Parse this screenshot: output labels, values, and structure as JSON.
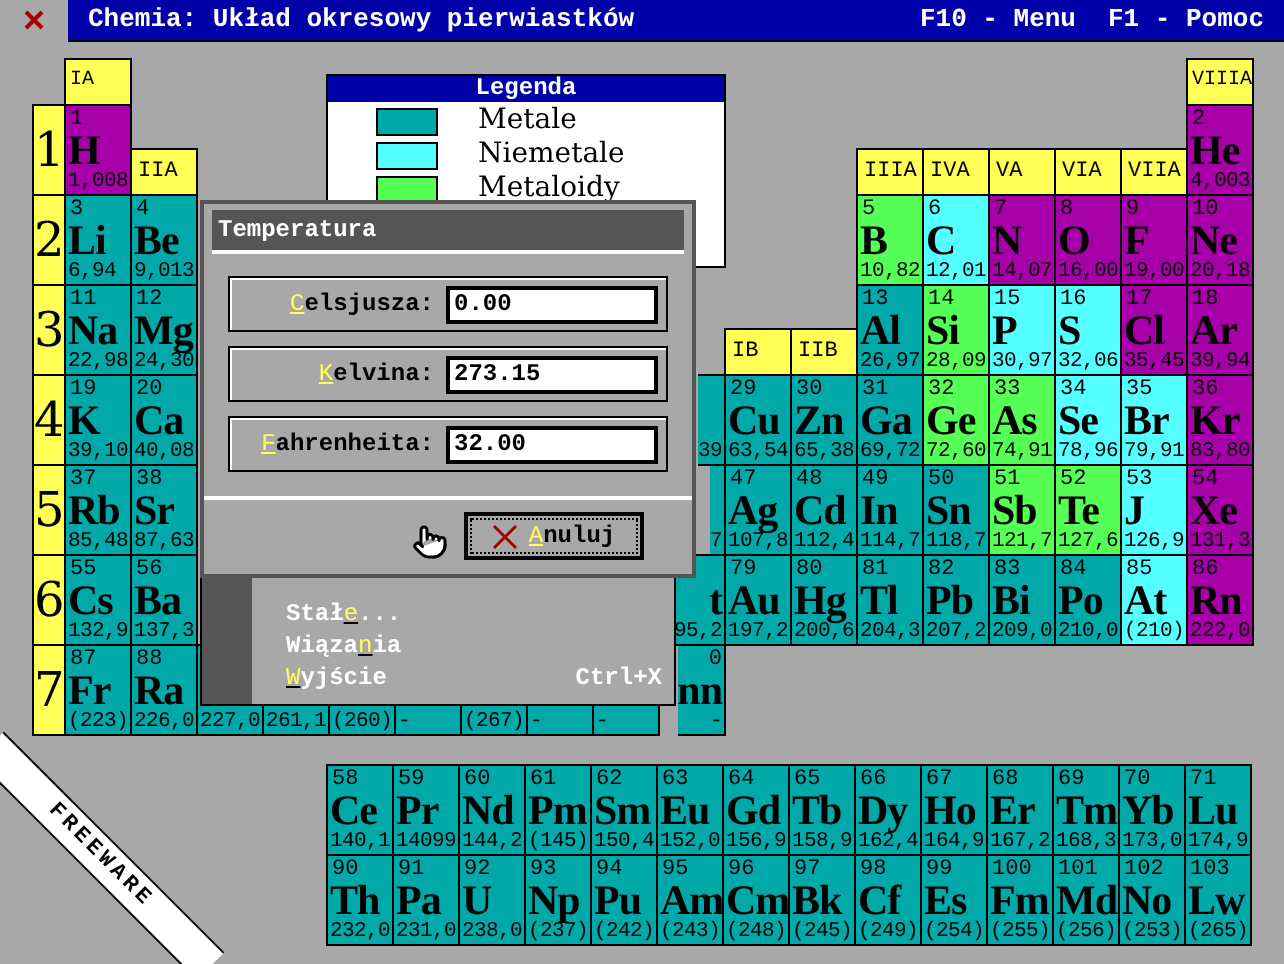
{
  "title_bar": {
    "title": "Chemia: Układ okresowy pierwiastków",
    "hints": [
      "F10 - Menu",
      "F1 - Pomoc"
    ]
  },
  "table": {
    "rows": [
      {
        "cells": [
          {
            "kind": "header",
            "text": "IA"
          },
          {
            "kind": "empty"
          },
          {
            "kind": "empty"
          },
          {
            "kind": "empty"
          },
          {
            "kind": "empty"
          },
          {
            "kind": "empty"
          },
          {
            "kind": "empty"
          },
          {
            "kind": "empty"
          },
          {
            "kind": "empty"
          },
          {
            "kind": "empty"
          },
          {
            "kind": "empty"
          },
          {
            "kind": "empty"
          },
          {
            "kind": "empty"
          },
          {
            "kind": "empty"
          },
          {
            "kind": "empty"
          },
          {
            "kind": "empty"
          },
          {
            "kind": "empty"
          },
          {
            "kind": "header",
            "text": "VIIIA"
          }
        ]
      },
      {
        "label": "1",
        "cells": [
          {
            "kind": "element",
            "number": "1",
            "symbol": "H",
            "mass": "1,008",
            "color": "#a800a8"
          },
          {
            "kind": "header",
            "text": "IIA"
          },
          {
            "kind": "empty"
          },
          {
            "kind": "empty"
          },
          {
            "kind": "empty"
          },
          {
            "kind": "empty"
          },
          {
            "kind": "empty"
          },
          {
            "kind": "empty"
          },
          {
            "kind": "empty"
          },
          {
            "kind": "empty"
          },
          {
            "kind": "empty"
          },
          {
            "kind": "empty"
          },
          {
            "kind": "header",
            "text": "IIIA"
          },
          {
            "kind": "header",
            "text": "IVA"
          },
          {
            "kind": "header",
            "text": "VA"
          },
          {
            "kind": "header",
            "text": "VIA"
          },
          {
            "kind": "header",
            "text": "VIIA"
          },
          {
            "kind": "element",
            "number": "2",
            "symbol": "He",
            "mass": "4,003",
            "color": "#a800a8"
          }
        ]
      },
      {
        "label": "2",
        "cells": [
          {
            "kind": "element",
            "number": "3",
            "symbol": "Li",
            "mass": "6,94",
            "color": "#00a8a8"
          },
          {
            "kind": "element",
            "number": "4",
            "symbol": "Be",
            "mass": "9,013",
            "color": "#00a8a8"
          },
          {
            "kind": "empty"
          },
          {
            "kind": "empty"
          },
          {
            "kind": "empty"
          },
          {
            "kind": "empty"
          },
          {
            "kind": "empty"
          },
          {
            "kind": "empty"
          },
          {
            "kind": "empty"
          },
          {
            "kind": "empty"
          },
          {
            "kind": "empty"
          },
          {
            "kind": "empty"
          },
          {
            "kind": "element",
            "number": "5",
            "symbol": "B",
            "mass": "10,82",
            "color": "#55ff55"
          },
          {
            "kind": "element",
            "number": "6",
            "symbol": "C",
            "mass": "12,01",
            "color": "#55ffff"
          },
          {
            "kind": "element",
            "number": "7",
            "symbol": "N",
            "mass": "14,07",
            "color": "#a800a8"
          },
          {
            "kind": "element",
            "number": "8",
            "symbol": "O",
            "mass": "16,00",
            "color": "#a800a8"
          },
          {
            "kind": "element",
            "number": "9",
            "symbol": "F",
            "mass": "19,00",
            "color": "#a800a8"
          },
          {
            "kind": "element",
            "number": "10",
            "symbol": "Ne",
            "mass": "20,18",
            "color": "#a800a8"
          }
        ]
      },
      {
        "label": "3",
        "cells": [
          {
            "kind": "element",
            "number": "11",
            "symbol": "Na",
            "mass": "22,98",
            "color": "#00a8a8"
          },
          {
            "kind": "element",
            "number": "12",
            "symbol": "Mg",
            "mass": "24,30",
            "color": "#00a8a8"
          },
          {
            "kind": "empty"
          },
          {
            "kind": "empty"
          },
          {
            "kind": "empty"
          },
          {
            "kind": "empty"
          },
          {
            "kind": "empty"
          },
          {
            "kind": "empty"
          },
          {
            "kind": "empty"
          },
          {
            "kind": "empty"
          },
          {
            "kind": "header",
            "text": "IB"
          },
          {
            "kind": "header",
            "text": "IIB"
          },
          {
            "kind": "element",
            "number": "13",
            "symbol": "Al",
            "mass": "26,97",
            "color": "#00a8a8"
          },
          {
            "kind": "element",
            "number": "14",
            "symbol": "Si",
            "mass": "28,09",
            "color": "#55ff55"
          },
          {
            "kind": "element",
            "number": "15",
            "symbol": "P",
            "mass": "30,97",
            "color": "#55ffff"
          },
          {
            "kind": "element",
            "number": "16",
            "symbol": "S",
            "mass": "32,06",
            "color": "#55ffff"
          },
          {
            "kind": "element",
            "number": "17",
            "symbol": "Cl",
            "mass": "35,45",
            "color": "#a800a8"
          },
          {
            "kind": "element",
            "number": "18",
            "symbol": "Ar",
            "mass": "39,94",
            "color": "#a800a8"
          }
        ]
      },
      {
        "label": "4",
        "cells": [
          {
            "kind": "element",
            "number": "19",
            "symbol": "K",
            "mass": "39,10",
            "color": "#00a8a8"
          },
          {
            "kind": "element",
            "number": "20",
            "symbol": "Ca",
            "mass": "40,08",
            "color": "#00a8a8"
          },
          {
            "kind": "empty"
          },
          {
            "kind": "empty"
          },
          {
            "kind": "empty"
          },
          {
            "kind": "empty"
          },
          {
            "kind": "empty"
          },
          {
            "kind": "empty"
          },
          {
            "kind": "empty"
          },
          {
            "kind": "clipped",
            "mass": "39",
            "color": "#00a8a8"
          },
          {
            "kind": "element",
            "number": "29",
            "symbol": "Cu",
            "mass": "63,54",
            "color": "#00a8a8"
          },
          {
            "kind": "element",
            "number": "30",
            "symbol": "Zn",
            "mass": "65,38",
            "color": "#00a8a8"
          },
          {
            "kind": "element",
            "number": "31",
            "symbol": "Ga",
            "mass": "69,72",
            "color": "#00a8a8"
          },
          {
            "kind": "element",
            "number": "32",
            "symbol": "Ge",
            "mass": "72,60",
            "color": "#55ff55"
          },
          {
            "kind": "element",
            "number": "33",
            "symbol": "As",
            "mass": "74,91",
            "color": "#55ff55"
          },
          {
            "kind": "element",
            "number": "34",
            "symbol": "Se",
            "mass": "78,96",
            "color": "#55ffff"
          },
          {
            "kind": "element",
            "number": "35",
            "symbol": "Br",
            "mass": "79,91",
            "color": "#55ffff"
          },
          {
            "kind": "element",
            "number": "36",
            "symbol": "Kr",
            "mass": "83,80",
            "color": "#a800a8"
          }
        ]
      },
      {
        "label": "5",
        "cells": [
          {
            "kind": "element",
            "number": "37",
            "symbol": "Rb",
            "mass": "85,48",
            "color": "#00a8a8"
          },
          {
            "kind": "element",
            "number": "38",
            "symbol": "Sr",
            "mass": "87,63",
            "color": "#00a8a8"
          },
          {
            "kind": "empty"
          },
          {
            "kind": "empty"
          },
          {
            "kind": "empty"
          },
          {
            "kind": "empty"
          },
          {
            "kind": "empty"
          },
          {
            "kind": "empty"
          },
          {
            "kind": "empty"
          },
          {
            "kind": "clipped",
            "mass": "7",
            "color": "#00a8a8"
          },
          {
            "kind": "element",
            "number": "47",
            "symbol": "Ag",
            "mass": "107,8",
            "color": "#00a8a8"
          },
          {
            "kind": "element",
            "number": "48",
            "symbol": "Cd",
            "mass": "112,4",
            "color": "#00a8a8"
          },
          {
            "kind": "element",
            "number": "49",
            "symbol": "In",
            "mass": "114,7",
            "color": "#00a8a8"
          },
          {
            "kind": "element",
            "number": "50",
            "symbol": "Sn",
            "mass": "118,7",
            "color": "#00a8a8"
          },
          {
            "kind": "element",
            "number": "51",
            "symbol": "Sb",
            "mass": "121,7",
            "color": "#55ff55"
          },
          {
            "kind": "element",
            "number": "52",
            "symbol": "Te",
            "mass": "127,6",
            "color": "#55ff55"
          },
          {
            "kind": "element",
            "number": "53",
            "symbol": "J",
            "mass": "126,9",
            "color": "#55ffff"
          },
          {
            "kind": "element",
            "number": "54",
            "symbol": "Xe",
            "mass": "131,3",
            "color": "#a800a8"
          }
        ]
      },
      {
        "label": "6",
        "cells": [
          {
            "kind": "element",
            "number": "55",
            "symbol": "Cs",
            "mass": "132,9",
            "color": "#00a8a8"
          },
          {
            "kind": "element",
            "number": "56",
            "symbol": "Ba",
            "mass": "137,3",
            "color": "#00a8a8"
          },
          {
            "kind": "empty"
          },
          {
            "kind": "empty"
          },
          {
            "kind": "empty"
          },
          {
            "kind": "empty"
          },
          {
            "kind": "empty"
          },
          {
            "kind": "empty"
          },
          {
            "kind": "empty"
          },
          {
            "kind": "clipped",
            "symbol": "t",
            "mass": "95,2",
            "color": "#00a8a8"
          },
          {
            "kind": "element",
            "number": "79",
            "symbol": "Au",
            "mass": "197,2",
            "color": "#00a8a8"
          },
          {
            "kind": "element",
            "number": "80",
            "symbol": "Hg",
            "mass": "200,6",
            "color": "#00a8a8"
          },
          {
            "kind": "element",
            "number": "81",
            "symbol": "Tl",
            "mass": "204,3",
            "color": "#00a8a8"
          },
          {
            "kind": "element",
            "number": "82",
            "symbol": "Pb",
            "mass": "207,2",
            "color": "#00a8a8"
          },
          {
            "kind": "element",
            "number": "83",
            "symbol": "Bi",
            "mass": "209,0",
            "color": "#00a8a8"
          },
          {
            "kind": "element",
            "number": "84",
            "symbol": "Po",
            "mass": "210,0",
            "color": "#00a8a8"
          },
          {
            "kind": "element",
            "number": "85",
            "symbol": "At",
            "mass": "(210)",
            "color": "#55ffff"
          },
          {
            "kind": "element",
            "number": "86",
            "symbol": "Rn",
            "mass": "222,0",
            "color": "#a800a8"
          }
        ]
      },
      {
        "label": "7",
        "cells": [
          {
            "kind": "element",
            "number": "87",
            "symbol": "Fr",
            "mass": "(223)",
            "color": "#00a8a8"
          },
          {
            "kind": "element",
            "number": "88",
            "symbol": "Ra",
            "mass": "226,0",
            "color": "#00a8a8"
          },
          {
            "kind": "element",
            "mass": "227,0",
            "color": "#00a8a8"
          },
          {
            "kind": "element",
            "mass": "261,1",
            "color": "#00a8a8"
          },
          {
            "kind": "element",
            "mass": "(260)",
            "color": "#00a8a8"
          },
          {
            "kind": "element",
            "mass": "-",
            "color": "#00a8a8"
          },
          {
            "kind": "element",
            "mass": "(267)",
            "color": "#00a8a8"
          },
          {
            "kind": "element",
            "mass": "-",
            "color": "#00a8a8"
          },
          {
            "kind": "element",
            "mass": "-",
            "color": "#00a8a8"
          },
          {
            "kind": "clipped",
            "number": "0",
            "symbol": "nn",
            "mass": "-",
            "color": "#00a8a8"
          },
          {
            "kind": "empty"
          },
          {
            "kind": "empty"
          },
          {
            "kind": "empty"
          },
          {
            "kind": "empty"
          },
          {
            "kind": "empty"
          },
          {
            "kind": "empty"
          },
          {
            "kind": "empty"
          },
          {
            "kind": "empty"
          }
        ]
      }
    ]
  },
  "f_block": {
    "rows": [
      [
        {
          "number": "58",
          "symbol": "Ce",
          "mass": "140,1",
          "color": "#00a8a8"
        },
        {
          "number": "59",
          "symbol": "Pr",
          "mass": "14099",
          "color": "#00a8a8"
        },
        {
          "number": "60",
          "symbol": "Nd",
          "mass": "144,2",
          "color": "#00a8a8"
        },
        {
          "number": "61",
          "symbol": "Pm",
          "mass": "(145)",
          "color": "#00a8a8"
        },
        {
          "number": "62",
          "symbol": "Sm",
          "mass": "150,4",
          "color": "#00a8a8"
        },
        {
          "number": "63",
          "symbol": "Eu",
          "mass": "152,0",
          "color": "#00a8a8"
        },
        {
          "number": "64",
          "symbol": "Gd",
          "mass": "156,9",
          "color": "#00a8a8"
        },
        {
          "number": "65",
          "symbol": "Tb",
          "mass": "158,9",
          "color": "#00a8a8"
        },
        {
          "number": "66",
          "symbol": "Dy",
          "mass": "162,4",
          "color": "#00a8a8"
        },
        {
          "number": "67",
          "symbol": "Ho",
          "mass": "164,9",
          "color": "#00a8a8"
        },
        {
          "number": "68",
          "symbol": "Er",
          "mass": "167,2",
          "color": "#00a8a8"
        },
        {
          "number": "69",
          "symbol": "Tm",
          "mass": "168,3",
          "color": "#00a8a8"
        },
        {
          "number": "70",
          "symbol": "Yb",
          "mass": "173,0",
          "color": "#00a8a8"
        },
        {
          "number": "71",
          "symbol": "Lu",
          "mass": "174,9",
          "color": "#00a8a8"
        }
      ],
      [
        {
          "number": "90",
          "symbol": "Th",
          "mass": "232,0",
          "color": "#00a8a8"
        },
        {
          "number": "91",
          "symbol": "Pa",
          "mass": "231,0",
          "color": "#00a8a8"
        },
        {
          "number": "92",
          "symbol": "U",
          "mass": "238,0",
          "color": "#00a8a8"
        },
        {
          "number": "93",
          "symbol": "Np",
          "mass": "(237)",
          "color": "#00a8a8"
        },
        {
          "number": "94",
          "symbol": "Pu",
          "mass": "(242)",
          "color": "#00a8a8"
        },
        {
          "number": "95",
          "symbol": "Am",
          "mass": "(243)",
          "color": "#00a8a8"
        },
        {
          "number": "96",
          "symbol": "Cm",
          "mass": "(248)",
          "color": "#00a8a8"
        },
        {
          "number": "97",
          "symbol": "Bk",
          "mass": "(245)",
          "color": "#00a8a8"
        },
        {
          "number": "98",
          "symbol": "Cf",
          "mass": "(249)",
          "color": "#00a8a8"
        },
        {
          "number": "99",
          "symbol": "Es",
          "mass": "(254)",
          "color": "#00a8a8"
        },
        {
          "number": "100",
          "symbol": "Fm",
          "mass": "(255)",
          "color": "#00a8a8"
        },
        {
          "number": "101",
          "symbol": "Md",
          "mass": "(256)",
          "color": "#00a8a8"
        },
        {
          "number": "102",
          "symbol": "No",
          "mass": "(253)",
          "color": "#00a8a8"
        },
        {
          "number": "103",
          "symbol": "Lw",
          "mass": "(265)",
          "color": "#00a8a8"
        }
      ]
    ]
  },
  "legend": {
    "title": "Legenda",
    "items": [
      {
        "label": "Metale",
        "color": "#00a8a8"
      },
      {
        "label": "Niemetale",
        "color": "#55ffff"
      },
      {
        "label": "Metaloidy",
        "color": "#55ff55"
      }
    ]
  },
  "menu": {
    "items": [
      {
        "label": "Stał**e**..."
      },
      {
        "label": "Wiąza**n**ia"
      },
      {
        "label": "**W**yjście",
        "shortcut": "Ctrl+X"
      }
    ]
  },
  "dialog": {
    "title": "Temperatura",
    "fields": [
      {
        "label": "**C**elsjusza:",
        "value": "0.00"
      },
      {
        "label": "**K**elvina:",
        "value": "273.15"
      },
      {
        "label": "**F**ahrenheita:",
        "value": "32.00"
      }
    ],
    "button": "**A**nuluj"
  },
  "corner_badge": "FREEWARE"
}
